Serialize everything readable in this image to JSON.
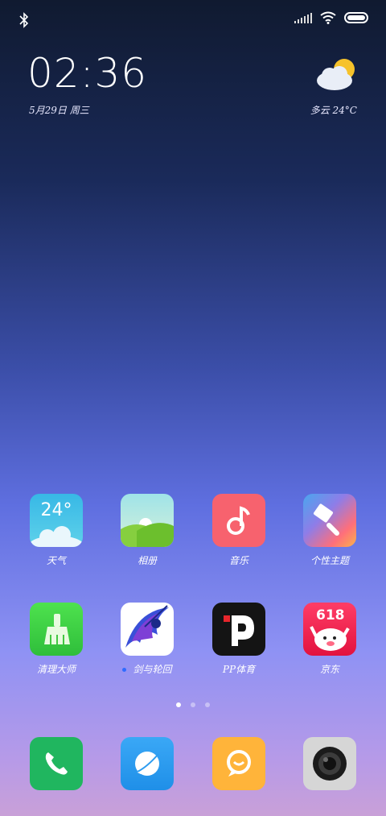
{
  "status": {
    "bluetooth_icon": "bluetooth-icon",
    "signal_icon": "signal-bars-icon",
    "wifi_icon": "wifi-icon",
    "battery_icon": "battery-icon"
  },
  "lock_widget": {
    "time": "02:36",
    "date": "5月29日 周三",
    "weather_text": "多云 24°C",
    "weather_icon": "partly-cloudy-icon"
  },
  "apps_row1": [
    {
      "label": "天气",
      "icon": "weather-app-icon",
      "tile_text": "24°",
      "color": "#3cc3e6"
    },
    {
      "label": "相册",
      "icon": "gallery-app-icon",
      "color": "#9fe3e8"
    },
    {
      "label": "音乐",
      "icon": "music-app-icon",
      "color": "#f7626e"
    },
    {
      "label": "个性主题",
      "icon": "themes-app-icon",
      "color": "#7b8cf0"
    }
  ],
  "apps_row2": [
    {
      "label": "清理大师",
      "icon": "cleaner-app-icon",
      "color": "#49d649"
    },
    {
      "label": "剑与轮回",
      "icon": "game-app-icon",
      "color": "#ffffff"
    },
    {
      "label": "PP体育",
      "icon": "pp-sports-app-icon",
      "color": "#111111"
    },
    {
      "label": "京东",
      "icon": "jd-app-icon",
      "tile_text": "618",
      "color": "#f02d5a"
    }
  ],
  "page_indicator": {
    "count": 3,
    "active": 1
  },
  "dock": [
    {
      "icon": "phone-icon",
      "color": "#20b65f"
    },
    {
      "icon": "messages-icon",
      "color": "#2d9cf0"
    },
    {
      "icon": "browser-icon",
      "color": "#ffb43a"
    },
    {
      "icon": "camera-icon",
      "color": "#d6d6d6"
    }
  ]
}
